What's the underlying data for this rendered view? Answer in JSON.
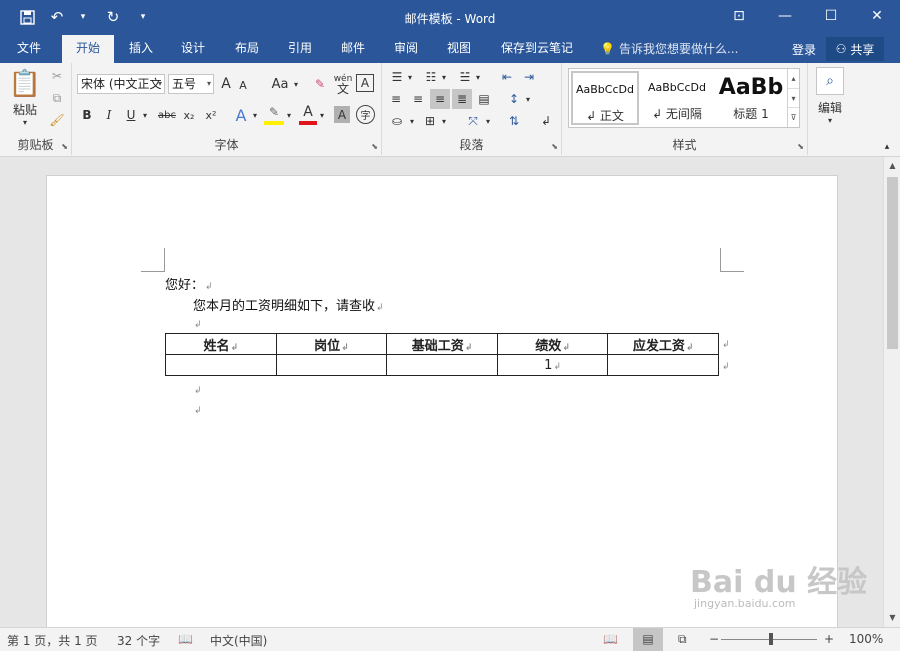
{
  "titlebar": {
    "title": "邮件模板 - Word",
    "qat": {
      "save_icon": "save-icon",
      "undo_icon": "undo-icon",
      "redo_icon": "redo-icon"
    },
    "window_controls": {
      "ribbon_options": "⊡",
      "minimize": "—",
      "maximize": "☐",
      "close": "✕"
    }
  },
  "menu": {
    "tabs": [
      {
        "label": "文件"
      },
      {
        "label": "开始"
      },
      {
        "label": "插入"
      },
      {
        "label": "设计"
      },
      {
        "label": "布局"
      },
      {
        "label": "引用"
      },
      {
        "label": "邮件"
      },
      {
        "label": "审阅"
      },
      {
        "label": "视图"
      },
      {
        "label": "保存到云笔记"
      }
    ],
    "active_tab": "开始",
    "tell_me": "告诉我您想要做什么...",
    "login": "登录",
    "share": "共享"
  },
  "ribbon": {
    "clipboard": {
      "label": "剪贴板",
      "paste": "粘贴"
    },
    "font": {
      "label": "字体",
      "font_name": "宋体 (中文正文",
      "font_size": "五号",
      "grow": "A",
      "shrink": "A",
      "change_case": "Aa",
      "pinyin_top": "wén",
      "pinyin_bottom": "文",
      "border_char": "A",
      "bold": "B",
      "italic": "I",
      "underline": "U",
      "strike": "abc",
      "subscript": "x₂",
      "superscript": "x²",
      "text_effect": "A",
      "font_color": "A",
      "char_shade": "A",
      "enclose": "字"
    },
    "paragraph": {
      "label": "段落"
    },
    "styles": {
      "label": "样式",
      "items": [
        {
          "preview": "AaBbCcDd",
          "name": "↲ 正文"
        },
        {
          "preview": "AaBbCcDd",
          "name": "↲ 无间隔"
        },
        {
          "preview": "AaBb",
          "name": "标题 1"
        }
      ]
    },
    "editing": {
      "label": "编辑"
    }
  },
  "document": {
    "greeting": "您好：",
    "body": "您本月的工资明细如下，请查收",
    "para_mark": "↲",
    "table": {
      "headers": [
        "姓名",
        "岗位",
        "基础工资",
        "绩效",
        "应发工资"
      ],
      "rows": [
        [
          "",
          "",
          "",
          "1",
          ""
        ]
      ]
    }
  },
  "statusbar": {
    "page": "第 1 页，共 1 页",
    "words": "32 个字",
    "language": "中文(中国)",
    "zoom_minus": "−",
    "zoom_plus": "+",
    "zoom": "100%"
  },
  "watermark": {
    "brand": "Bai du 经验",
    "url": "jingyan.baidu.com"
  }
}
